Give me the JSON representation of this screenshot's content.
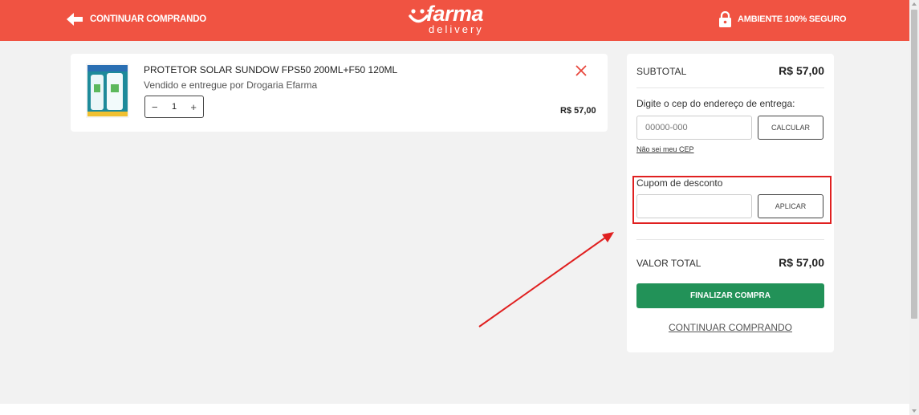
{
  "header": {
    "back_label": "CONTINUAR COMPRANDO",
    "logo_main": "farma",
    "logo_sub": "delivery",
    "secure_label": "AMBIENTE 100% SEGURO",
    "brand_color": "#f05342"
  },
  "cart": {
    "items": [
      {
        "name": "PROTETOR SOLAR SUNDOW FPS50 200ML+F50 120ML",
        "seller": "Vendido e entregue por Drogaria Efarma",
        "quantity": "1",
        "minus": "−",
        "plus": "+",
        "price": "R$ 57,00"
      }
    ]
  },
  "summary": {
    "subtotal_label": "SUBTOTAL",
    "subtotal_value": "R$ 57,00",
    "cep_prompt": "Digite o cep do endereço de entrega:",
    "cep_placeholder": "00000-000",
    "cep_button": "CALCULAR",
    "cep_help_link": "Não sei meu CEP",
    "coupon_label": "Cupom de desconto",
    "coupon_placeholder": "",
    "coupon_button": "APLICAR",
    "total_label": "VALOR TOTAL",
    "total_value": "R$ 57,00",
    "checkout_button": "FINALIZAR COMPRA",
    "continue_link": "CONTINUAR COMPRANDO",
    "checkout_color": "#229258"
  },
  "icons": {
    "back": "arrow-left-icon",
    "secure": "lock-icon",
    "remove": "close-icon"
  }
}
